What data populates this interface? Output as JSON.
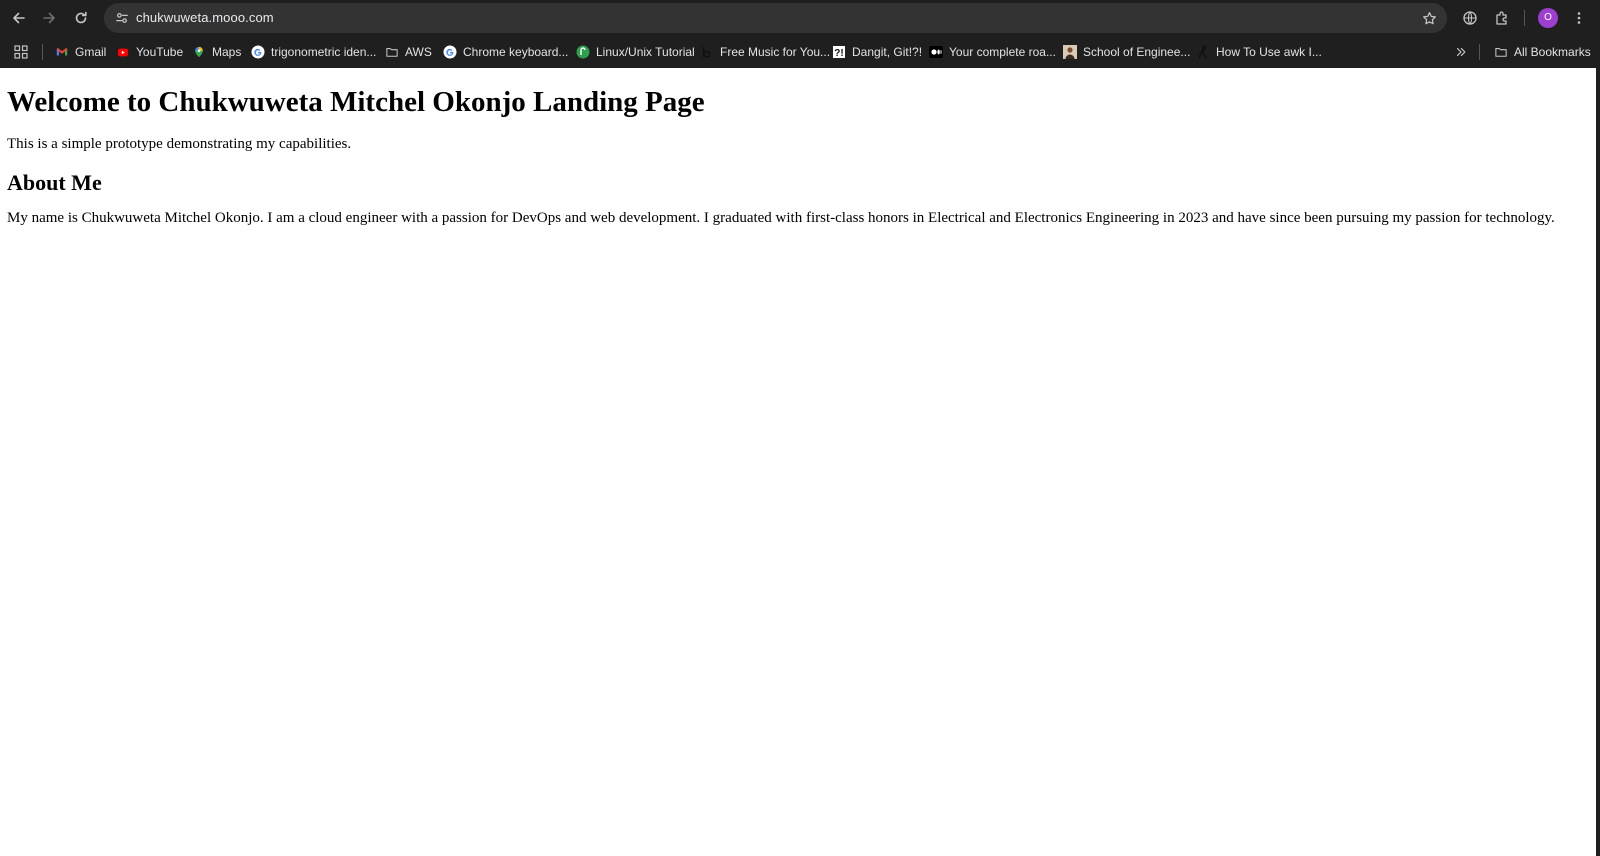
{
  "browser": {
    "url": "chukwuweta.mooo.com",
    "profile_initial": "O",
    "accent_color": "#9c3fd1"
  },
  "bookmarks": {
    "items": [
      {
        "label": "Gmail",
        "icon": "gmail-icon"
      },
      {
        "label": "YouTube",
        "icon": "youtube-icon"
      },
      {
        "label": "Maps",
        "icon": "maps-icon"
      },
      {
        "label": "trigonometric iden...",
        "icon": "google-icon"
      },
      {
        "label": "AWS",
        "icon": "folder-icon"
      },
      {
        "label": "Chrome keyboard...",
        "icon": "google-icon"
      },
      {
        "label": "Linux/Unix Tutorial",
        "icon": "linux-tutorial-icon"
      },
      {
        "label": "Free Music for You...",
        "icon": "bensound-icon"
      },
      {
        "label": "Dangit, Git!?!",
        "icon": "dangit-git-icon"
      },
      {
        "label": "Your complete roa...",
        "icon": "medium-icon"
      },
      {
        "label": "School of Enginee...",
        "icon": "school-icon"
      },
      {
        "label": "How To Use awk I...",
        "icon": "awk-icon"
      }
    ],
    "all_bookmarks_label": "All Bookmarks"
  },
  "page": {
    "title": "Welcome to Chukwuweta Mitchel Okonjo Landing Page",
    "lead": "This is a simple prototype demonstrating my capabilities.",
    "about_heading": "About Me",
    "about_text": "My name is Chukwuweta Mitchel Okonjo. I am a cloud engineer with a passion for DevOps and web development. I graduated with first-class honors in Electrical and Electronics Engineering in 2023 and have since been pursuing my passion for technology."
  }
}
